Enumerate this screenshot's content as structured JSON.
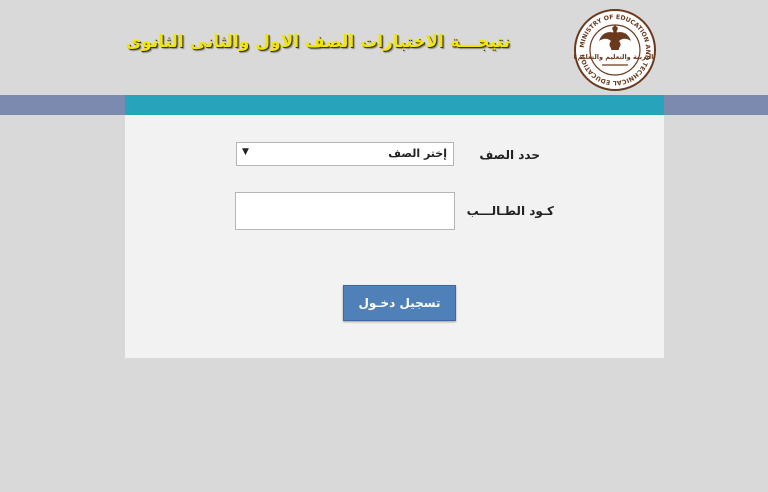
{
  "header": {
    "title": "نتيجـــة  الاختبارات الصف الاول والثانى الثانوى",
    "logo": {
      "icon": "ministry-eagle-seal",
      "arabic_text": "وزارة التربية والتعليم والتعليم الفنى",
      "english_text": "MINISTRY OF EDUCATION AND TECHNICAL EDUCATION"
    }
  },
  "colors": {
    "background": "#d9d9d9",
    "band_outer": "#7c8ab0",
    "band_inner": "#27a4bc",
    "panel": "#f2f2f2",
    "title": "#f2e600",
    "button": "#4f81b8"
  },
  "form": {
    "grade_label": "حدد الصف",
    "grade_select_value": "إختر الصف",
    "code_label": "كـود الطـالـــب",
    "code_value": "",
    "submit_label": "تسجيل دخـول"
  }
}
